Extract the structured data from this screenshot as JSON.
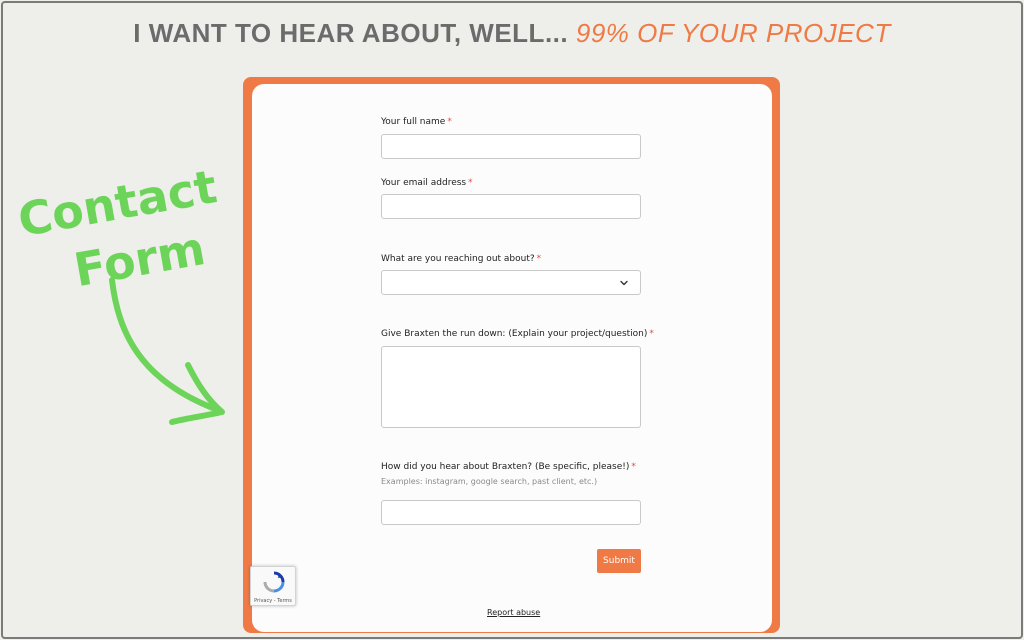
{
  "header": {
    "lead": "I WANT TO HEAR ABOUT, WELL...",
    "accent": "99% OF YOUR PROJECT"
  },
  "annotation": {
    "line1": "Contact",
    "line2": "Form",
    "color": "#6dd45a"
  },
  "form": {
    "fields": [
      {
        "label": "Your full name",
        "required": "*",
        "value": ""
      },
      {
        "label": "Your email address",
        "required": "*",
        "value": ""
      },
      {
        "label": "What are you reaching out about?",
        "required": "*",
        "selected": ""
      },
      {
        "label": "Give Braxten the run down: (Explain your project/question)",
        "required": "*",
        "value": ""
      },
      {
        "label": "How did you hear about Braxten? (Be specific, please!)",
        "required": "*",
        "hint": "Examples: instagram, google search, past client, etc.)",
        "value": ""
      }
    ],
    "submit_label": "Submit"
  },
  "recaptcha": {
    "links": "Privacy - Terms"
  },
  "footer": {
    "report_label": "Report abuse"
  },
  "colors": {
    "accent": "#ef7a45",
    "background": "#eeeeea",
    "annotation": "#6dd45a"
  }
}
